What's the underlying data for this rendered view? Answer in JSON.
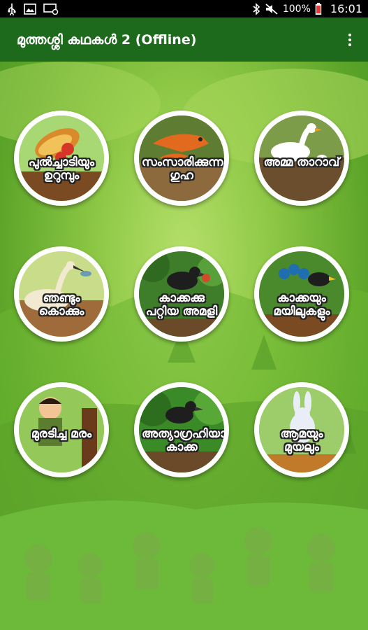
{
  "status_bar": {
    "battery": "100%",
    "time": "16:01",
    "icons": [
      "usb-icon",
      "image-icon",
      "screen-icon",
      "bluetooth-icon",
      "mute-icon",
      "battery-icon"
    ]
  },
  "app_bar": {
    "title": "മുത്തശ്ശി കഥകൾ 2 (Offline)",
    "menu_icon": "more-vert-icon"
  },
  "colors": {
    "app_bar": "#1d6a1d",
    "status_bar": "#000000",
    "background": "#8cc744"
  },
  "stories": [
    {
      "label": "പുൽച്ചാടിയും ഉറുമ്പും",
      "scene": "grasshopper-ant"
    },
    {
      "label": "സംസാരിക്കുന്ന ഗുഹ",
      "scene": "fox-cave"
    },
    {
      "label": "അമ്മ താറാവ്",
      "scene": "duck"
    },
    {
      "label": "ഞണ്ടും കൊക്കും",
      "scene": "crane-crab"
    },
    {
      "label": "കാക്കക്കു പറ്റിയ അമളി",
      "scene": "crow-nest"
    },
    {
      "label": "കാക്കയും മയിലുകളും",
      "scene": "crow-peacock"
    },
    {
      "label": "മുരടിച്ച മരം",
      "scene": "boy-tree"
    },
    {
      "label": "അത്യാഗ്രഹിയായ കാക്ക",
      "scene": "greedy-crow"
    },
    {
      "label": "ആമയും മുയലും",
      "scene": "tortoise-hare"
    }
  ]
}
